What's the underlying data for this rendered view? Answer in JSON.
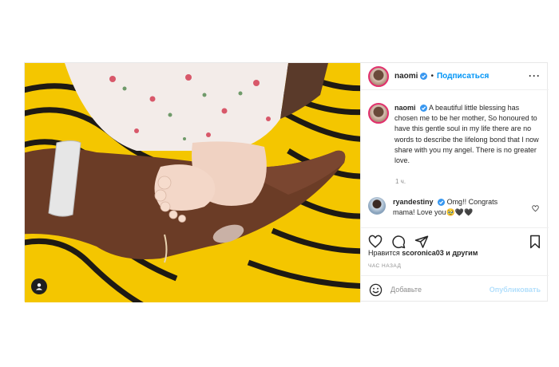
{
  "post": {
    "author": "naomi",
    "follow_label": "Подписаться",
    "caption_author": "naomi",
    "caption_text": "A beautiful little blessing has chosen me to be her mother, So honoured to have this gentle soul in my life there are no words to describe the lifelong bond that I now share with you my angel. There is no greater love.",
    "caption_time": "1 ч.",
    "comment": {
      "author": "ryandestiny",
      "text": "Omg!! Congrats mama! Love you🥹🖤🖤"
    },
    "likes_prefix": "Нравится",
    "likes_user": "scoronica03",
    "likes_suffix": "и другим",
    "time_ago": "ЧАС НАЗАД",
    "comment_placeholder": "Добавьте",
    "publish_label": "Опубликовать"
  },
  "colors": {
    "accent": "#0095f6",
    "verified": "#3897f0",
    "background_yellow": "#f2c400"
  },
  "icons": {
    "more": "more-icon",
    "verified": "verified-badge-icon",
    "heart": "heart-icon",
    "comment": "comment-icon",
    "share": "share-icon",
    "save": "bookmark-icon",
    "emoji": "emoji-icon",
    "user_tag": "user-tag-icon"
  }
}
